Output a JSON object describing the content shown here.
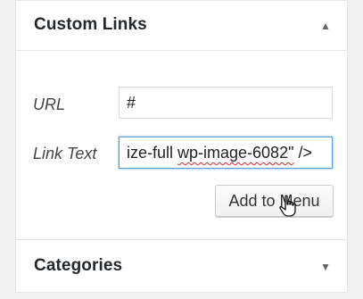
{
  "custom_links": {
    "title": "Custom Links",
    "toggle_icon": "triangle-up-icon",
    "url_label": "URL",
    "url_value": "#",
    "link_text_label": "Link Text",
    "link_text_prefix": "ize-full ",
    "link_text_misspelled": "wp-image-6082\"",
    "link_text_suffix": " />",
    "add_button": "Add to Menu"
  },
  "categories": {
    "title": "Categories",
    "toggle_icon": "triangle-down-icon"
  },
  "colors": {
    "background": "#f1f1f1",
    "focus_border": "#5b9dd9",
    "spellcheck": "#e0263a"
  }
}
